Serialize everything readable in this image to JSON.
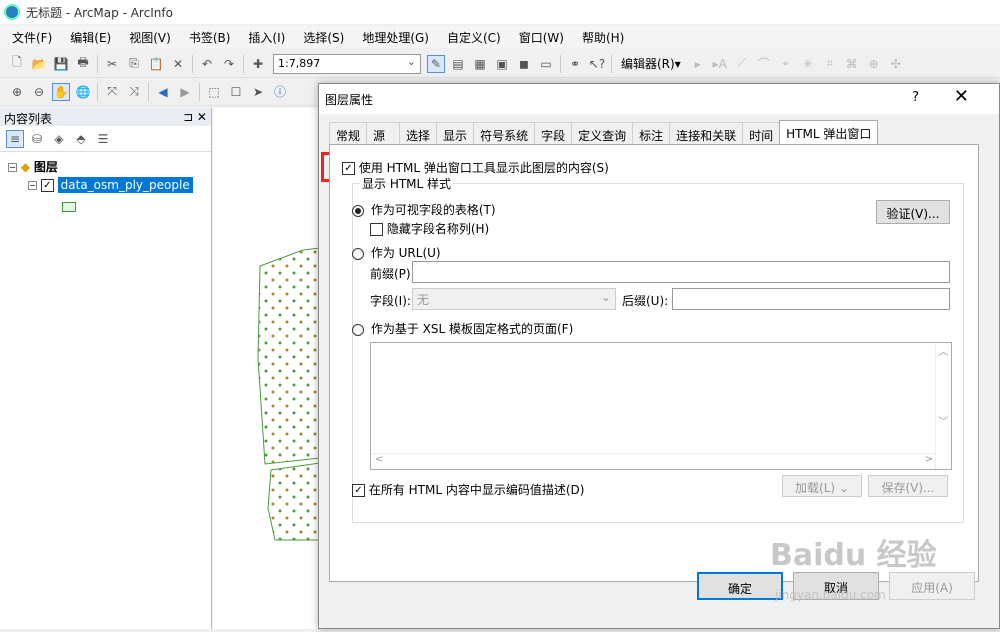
{
  "window": {
    "title": "无标题 - ArcMap - ArcInfo"
  },
  "menu": [
    "文件(F)",
    "编辑(E)",
    "视图(V)",
    "书签(B)",
    "插入(I)",
    "选择(S)",
    "地理处理(G)",
    "自定义(C)",
    "窗口(W)",
    "帮助(H)"
  ],
  "toolbar": {
    "scale": "1:7,897",
    "editor_label": "编辑器(R)▾"
  },
  "toc": {
    "title": "内容列表",
    "pin": "⊐ ✕",
    "group_label": "图层",
    "layer_name": "data_osm_ply_people"
  },
  "dialog": {
    "title": "图层属性",
    "help": "?",
    "close": "✕",
    "tabs": [
      "常规",
      "源",
      "选择",
      "显示",
      "符号系统",
      "字段",
      "定义查询",
      "标注",
      "连接和关联",
      "时间",
      "HTML 弹出窗口"
    ],
    "active_tab": "HTML 弹出窗口",
    "use_html_checkbox": "使用 HTML 弹出窗口工具显示此图层的内容(S)",
    "group_title": "显示 HTML 样式",
    "option_table": "作为可视字段的表格(T)",
    "hide_field_names": "隐藏字段名称列(H)",
    "verify_button": "验证(V)...",
    "option_url": "作为 URL(U)",
    "prefix_label": "前缀(P):",
    "field_label": "字段(I):",
    "field_value": "无",
    "suffix_label": "后缀(U):",
    "option_xsl": "作为基于 XSL 模板固定格式的页面(F)",
    "show_coded_values": "在所有 HTML 内容中显示编码值描述(D)",
    "load_button": "加载(L)",
    "save_button": "保存(V)...",
    "ok_button": "确定",
    "cancel_button": "取消",
    "apply_button": "应用(A)"
  },
  "watermark": {
    "brand": "Baidu 经验",
    "url": "jingyan.baidu.com"
  }
}
